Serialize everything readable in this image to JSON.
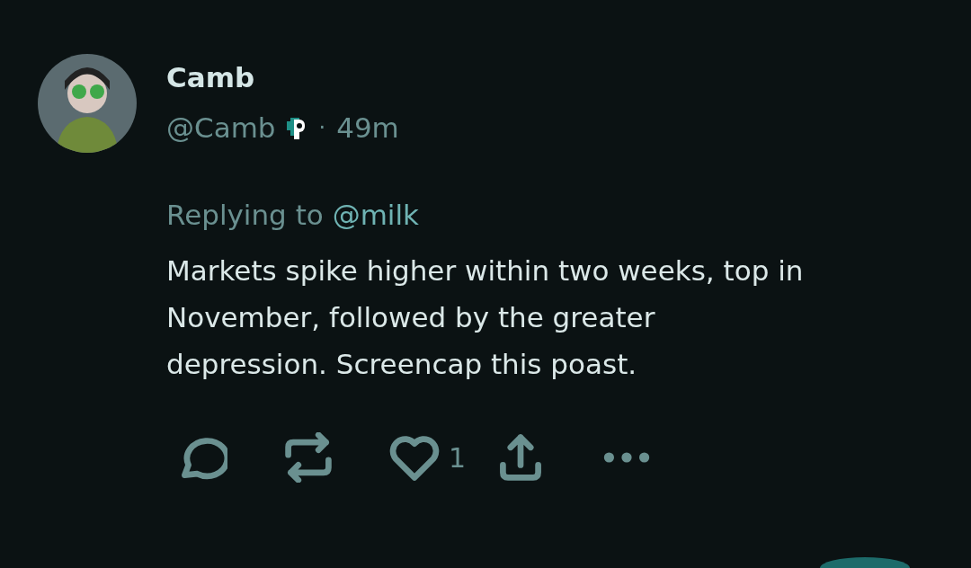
{
  "post": {
    "author": {
      "name": "Camb",
      "handle": "@Camb",
      "separator": "·",
      "time": "49m"
    },
    "reply_prefix": "Replying to",
    "reply_to": "@milk",
    "body": "Markets spike higher within two weeks, top in November, followed by the greater depression. Screencap this poast.",
    "actions": [
      {
        "kind": "reply"
      },
      {
        "kind": "repost"
      },
      {
        "kind": "like",
        "count": "1"
      },
      {
        "kind": "share"
      },
      {
        "kind": "more"
      }
    ]
  }
}
